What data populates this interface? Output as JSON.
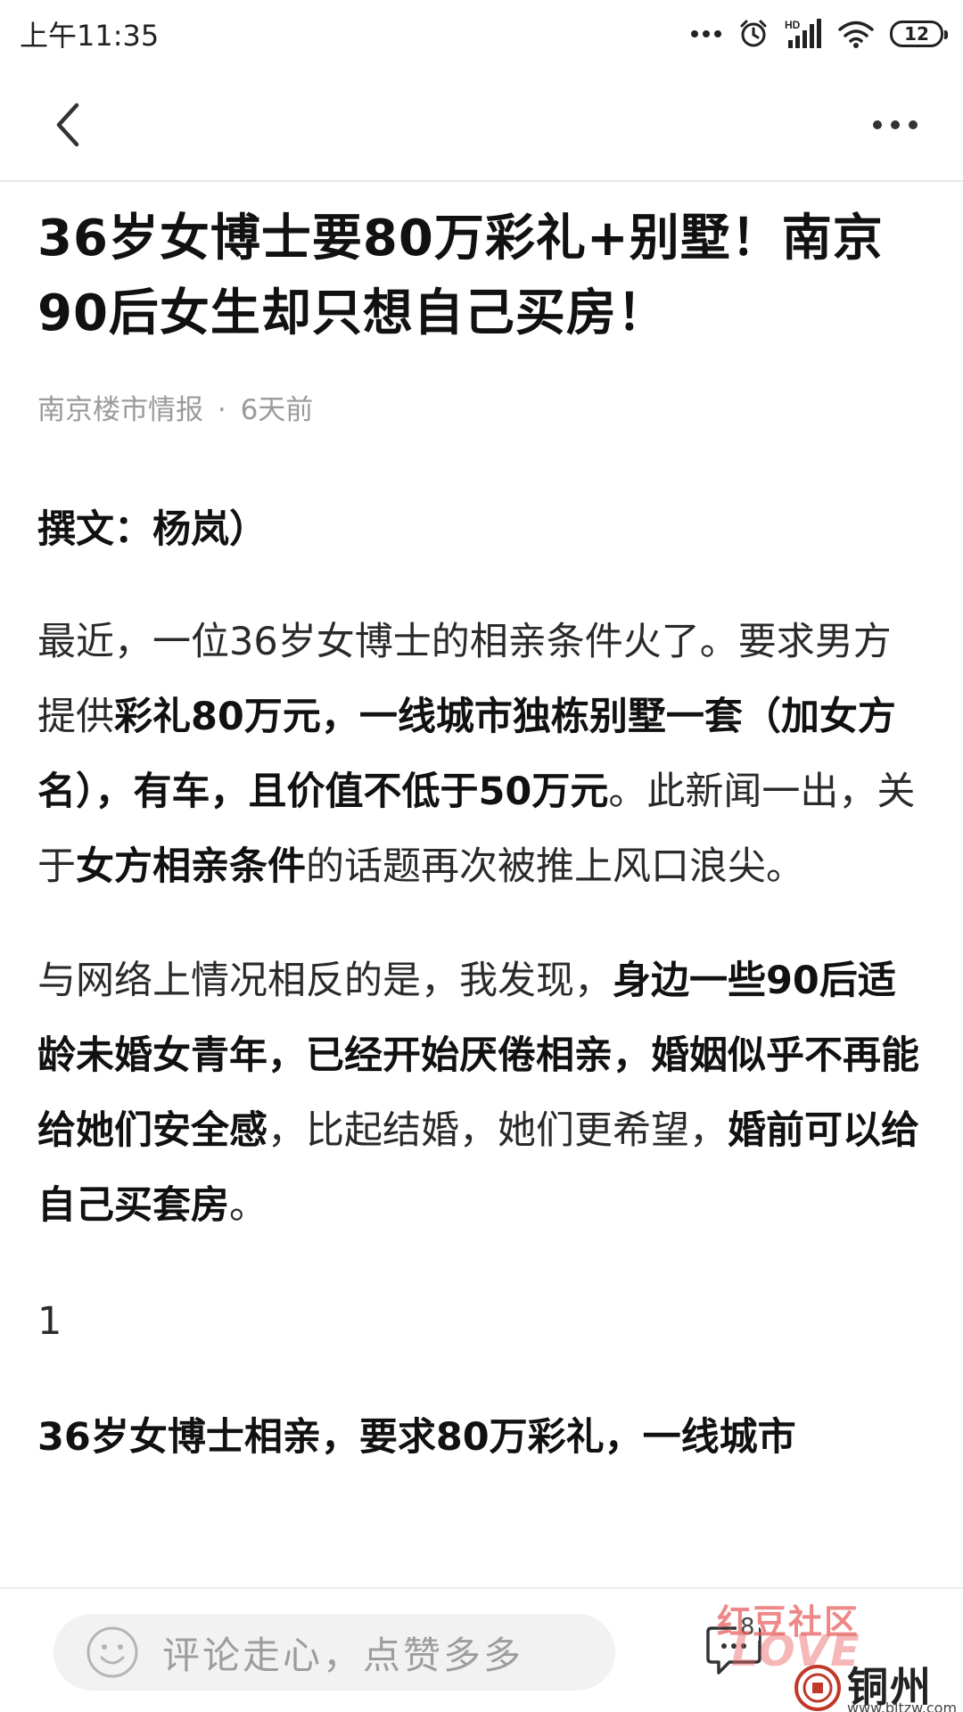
{
  "status_bar": {
    "time": "上午11:35",
    "network_label": "HD",
    "battery_level": "12",
    "icons": [
      "more-dots-icon",
      "alarm-icon",
      "signal-icon",
      "wifi-icon",
      "battery-icon"
    ]
  },
  "nav": {
    "back_icon": "chevron-left-icon",
    "more_icon": "more-horizontal-icon"
  },
  "article": {
    "title": "36岁女博士要80万彩礼+别墅！南京90后女生却只想自己买房！",
    "source": "南京楼市情报",
    "separator": "·",
    "time_ago": "6天前",
    "byline": "撰文：杨岚）",
    "para1_a": "最近，一位36岁女博士的相亲条件火了。要求男方提供",
    "para1_b": "彩礼80万元，一线城市独栋别墅一套（加女方名），有车，且价值不低于50万元",
    "para1_c": "。此新闻一出，关于",
    "para1_d": "女方相亲条件",
    "para1_e": "的话题再次被推上风口浪尖。",
    "para2_a": "与网络上情况相反的是，我发现，",
    "para2_b": "身边一些90后适龄未婚女青年，已经开始厌倦相亲，婚姻似乎不再能给她们安全感",
    "para2_c": "，比起结婚，她们更希望，",
    "para2_d": "婚前可以给自己买套房",
    "para2_e": "。",
    "section_number": "1",
    "para3": "36岁女博士相亲，要求80万彩礼，一线城市"
  },
  "bottom_bar": {
    "comment_placeholder": "评论走心，点赞多多",
    "comment_count": "8",
    "emoji_icon": "smiley-icon",
    "comments_icon": "chat-bubble-icon"
  },
  "watermark": {
    "top_text": "红豆社区",
    "brand": "铜州网",
    "url": "www.bltzw.com"
  },
  "colors": {
    "text": "#1b1b1b",
    "meta": "#9a9a9a",
    "input_bg": "#f2f2f2",
    "watermark_red": "#e86060"
  }
}
